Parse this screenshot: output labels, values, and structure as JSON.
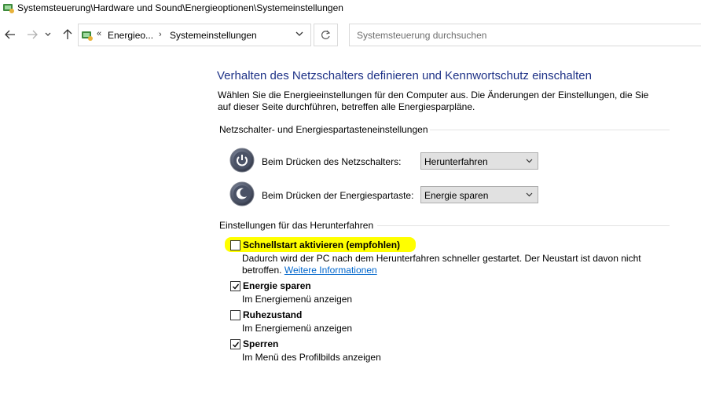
{
  "window": {
    "title": "Systemsteuerung\\Hardware und Sound\\Energieoptionen\\Systemeinstellungen"
  },
  "address": {
    "crumbs": [
      "Energieo...",
      "Systemeinstellungen"
    ],
    "overflow_label": "«"
  },
  "search": {
    "placeholder": "Systemsteuerung durchsuchen"
  },
  "main": {
    "heading": "Verhalten des Netzschalters definieren und Kennwortschutz einschalten",
    "description": "Wählen Sie die Energieeinstellungen für den Computer aus. Die Änderungen der Einstellungen, die Sie auf dieser Seite durchführen, betreffen alle Energiesparpläne.",
    "power_group_label": "Netzschalter- und Energiespartasteneinstellungen",
    "power_button_label": "Beim Drücken des Netzschalters:",
    "power_button_value": "Herunterfahren",
    "sleep_button_label": "Beim Drücken der Energiespartaste:",
    "sleep_button_value": "Energie sparen",
    "shutdown_group_label": "Einstellungen für das Herunterfahren",
    "options": [
      {
        "title": "Schnellstart aktivieren (empfohlen)",
        "desc": "Dadurch wird der PC nach dem Herunterfahren schneller gestartet. Der Neustart ist davon nicht betroffen.",
        "link": "Weitere Informationen",
        "checked": false
      },
      {
        "title": "Energie sparen",
        "desc": "Im Energiemenü anzeigen",
        "checked": true
      },
      {
        "title": "Ruhezustand",
        "desc": "Im Energiemenü anzeigen",
        "checked": false
      },
      {
        "title": "Sperren",
        "desc": "Im Menü des Profilbilds anzeigen",
        "checked": true
      }
    ]
  },
  "colors": {
    "heading": "#1e3287",
    "link": "#0066cc",
    "highlight": "#ffff00"
  }
}
